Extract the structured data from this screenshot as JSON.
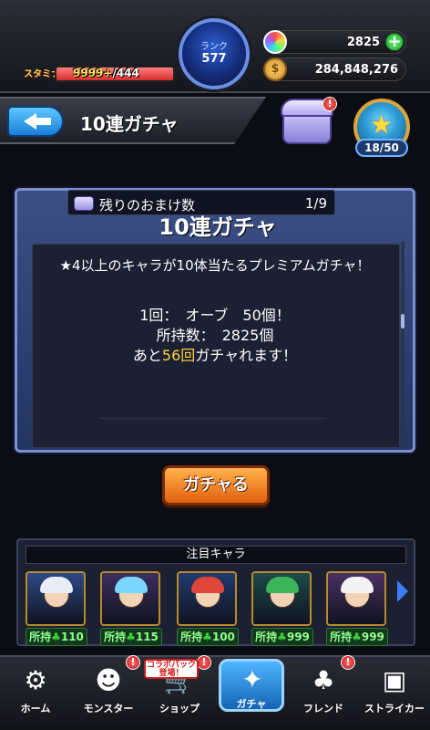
{
  "header": {
    "stamina_label": "スタミナ",
    "stamina_current": "9999+",
    "stamina_max": "/444",
    "stamina_fill": 1.0,
    "rank_label": "ランク",
    "rank_value": "577",
    "orbs": "2825",
    "gold": "284,848,276",
    "add_icon": "plus-icon",
    "orb_icon": "rainbow-orb-icon",
    "coin_icon": "gold-coin-icon"
  },
  "title_bar": {
    "title": "10連ガチャ",
    "back_icon": "back-arrow-icon",
    "chest_alert": "!",
    "medal_count": "18/50"
  },
  "panel": {
    "title": "10連ガチャ",
    "description": "★4以上のキャラが10体当たるプレミアムガチャ！",
    "cost_line": "1回：　オーブ　50個！",
    "owned_line": "所持数：　2825個",
    "remaining_prefix": "あと",
    "remaining_count": "56回",
    "remaining_suffix": "ガチャれます！",
    "bonus_label": "残りのおまけ数",
    "bonus_value": "1/9"
  },
  "gacha_button": {
    "label": "ガチャる"
  },
  "featured": {
    "title": "注目キャラ",
    "characters": [
      {
        "owned_label": "所持",
        "count": "110",
        "hair": "#e8eef7",
        "bg": "#2d4a86"
      },
      {
        "owned_label": "所持",
        "count": "115",
        "hair": "#7ad6ff",
        "bg": "#3a2f5e"
      },
      {
        "owned_label": "所持",
        "count": "100",
        "hair": "#e0463a",
        "bg": "#1f3a70"
      },
      {
        "owned_label": "所持",
        "count": "999",
        "hair": "#3cb45a",
        "bg": "#1e4a4a"
      },
      {
        "owned_label": "所持",
        "count": "999",
        "hair": "#f3f3f3",
        "bg": "#4a3064"
      }
    ]
  },
  "nav": {
    "items": [
      {
        "label": "ホーム",
        "icon": "home-icon",
        "glyph": "⚙"
      },
      {
        "label": "モンスター",
        "icon": "monster-icon",
        "glyph": "☻"
      },
      {
        "label": "ショップ",
        "icon": "shop-cart-icon",
        "glyph": "🛒"
      },
      {
        "label": "ガチャ",
        "icon": "gacha-icon",
        "glyph": "✦"
      },
      {
        "label": "フレンド",
        "icon": "friends-icon",
        "glyph": "♣"
      },
      {
        "label": "ストライカー",
        "icon": "striker-icon",
        "glyph": "▣"
      }
    ],
    "collab_badge": "コラボパック登場！",
    "alert": "!"
  }
}
